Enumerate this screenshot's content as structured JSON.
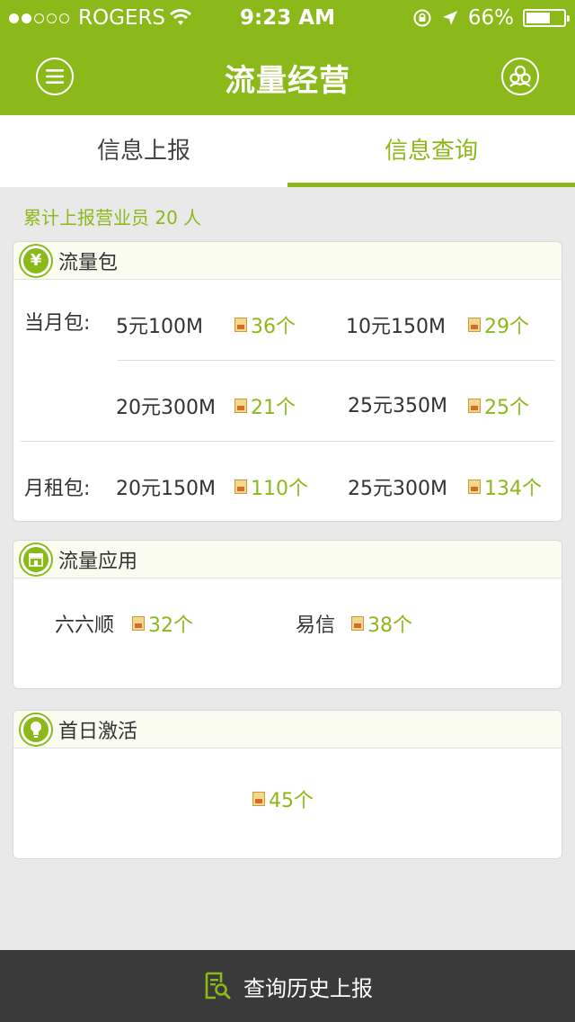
{
  "status_bar": {
    "carrier": "ROGERS",
    "time": "9:23 AM",
    "battery": "66%",
    "battery_level": 0.66,
    "signal_bars_filled": 2,
    "signal_bars_total": 5
  },
  "nav": {
    "title": "流量经营",
    "menu_icon": "menu-icon",
    "user_icon": "user-group-icon"
  },
  "tabs": [
    {
      "label": "信息上报",
      "active": false
    },
    {
      "label": "信息查询",
      "active": true
    }
  ],
  "summary": "累计上报营业员 20 人",
  "traffic_package": {
    "title": "流量包",
    "icon": "yuan-icon",
    "monthly_label": "当月包:",
    "monthly_items": [
      {
        "name": "5元100M",
        "count": "36个"
      },
      {
        "name": "10元150M",
        "count": "29个"
      },
      {
        "name": "20元300M",
        "count": "21个"
      },
      {
        "name": "25元350M",
        "count": "25个"
      }
    ],
    "rental_label": "月租包:",
    "rental_items": [
      {
        "name": "20元150M",
        "count": "110个"
      },
      {
        "name": "25元300M",
        "count": "134个"
      }
    ]
  },
  "traffic_app": {
    "title": "流量应用",
    "icon": "store-icon",
    "items": [
      {
        "name": "六六顺",
        "count": "32个"
      },
      {
        "name": "易信",
        "count": "38个"
      }
    ]
  },
  "first_day": {
    "title": "首日激活",
    "icon": "lightbulb-icon",
    "count": "45个"
  },
  "bottom": {
    "label": "查询历史上报",
    "icon": "document-search-icon"
  },
  "colors": {
    "accent": "#8cb91a",
    "bottom_bar": "#3a3a3a"
  }
}
